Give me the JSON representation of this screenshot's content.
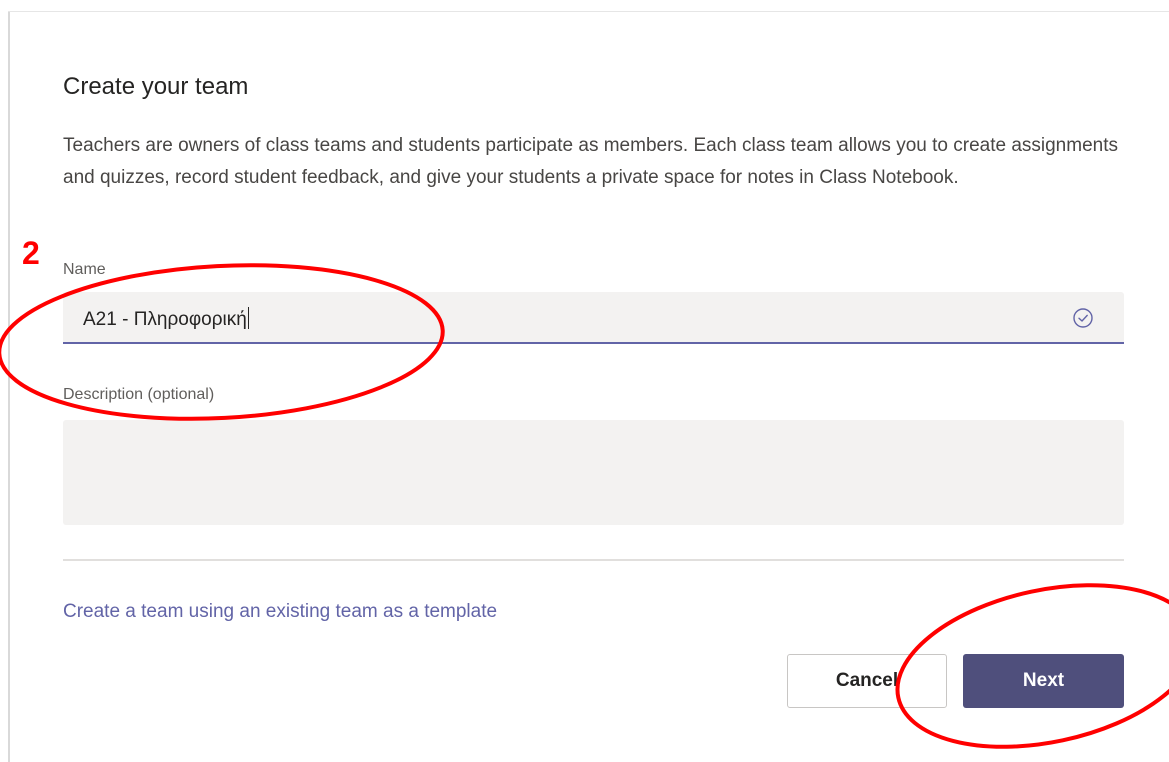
{
  "dialog": {
    "title": "Create your team",
    "intro": "Teachers are owners of class teams and students participate as members. Each class team allows you to create assignments and quizzes, record student feedback, and give your students a private space for notes in Class Notebook."
  },
  "fields": {
    "name": {
      "label": "Name",
      "value": "A21 - Πληροφορική"
    },
    "description": {
      "label": "Description (optional)",
      "value": ""
    }
  },
  "links": {
    "template": "Create a team using an existing team as a template"
  },
  "buttons": {
    "cancel": "Cancel",
    "next": "Next"
  },
  "annotation": {
    "step_number": "2",
    "color": "#ff0000"
  },
  "colors": {
    "accent": "#6264a7",
    "primary_button": "#4f4f7c",
    "input_background": "#f3f2f1"
  },
  "icons": {
    "name_valid": "check-circle-icon"
  }
}
